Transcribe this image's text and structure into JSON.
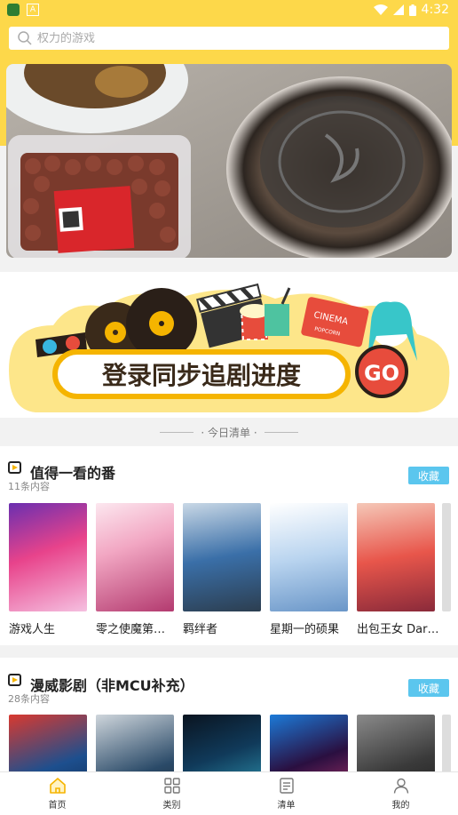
{
  "status_bar": {
    "time": "4:32"
  },
  "search": {
    "placeholder": "权力的游戏"
  },
  "today_list": {
    "label": "今日清单"
  },
  "promo": {
    "text": "登录同步追剧进度",
    "go_label": "GO",
    "cinema_label": "CINEMA",
    "popcorn_label": "POPCORN"
  },
  "sections": [
    {
      "title": "值得一看的番",
      "count": "11条内容",
      "fav_label": "收藏",
      "items": [
        {
          "title": "游戏人生",
          "colors": [
            "#e8438b",
            "#6a2fb0",
            "#f5c0e0"
          ]
        },
        {
          "title": "零之使魔第…",
          "colors": [
            "#f2a7c3",
            "#b33a6f",
            "#fce7ef"
          ]
        },
        {
          "title": "羁绊者",
          "colors": [
            "#3a6fa8",
            "#c9d8e6",
            "#2c3e50"
          ]
        },
        {
          "title": "星期一的硕果",
          "colors": [
            "#b9d4ef",
            "#ffffff",
            "#6a96c8"
          ]
        },
        {
          "title": "出包王女 Dar…",
          "colors": [
            "#e8564b",
            "#f5c8b8",
            "#8a2a3a"
          ]
        }
      ]
    },
    {
      "title": "漫威影剧（非MCU补充）",
      "count": "28条内容",
      "fav_label": "收藏",
      "items": [
        {
          "title": "",
          "colors": [
            "#1d4f8e",
            "#d9392f",
            "#0b1e3a"
          ]
        },
        {
          "title": "",
          "colors": [
            "#cfd6dc",
            "#2a4a68",
            "#1a1a1a"
          ]
        },
        {
          "title": "",
          "colors": [
            "#103a5a",
            "#3cc0d8",
            "#0a1420"
          ]
        },
        {
          "title": "",
          "colors": [
            "#2a0f40",
            "#e3427b",
            "#1c7ad8"
          ]
        },
        {
          "title": "",
          "colors": [
            "#3a3a3a",
            "#8a8a8a",
            "#111111"
          ]
        }
      ]
    }
  ],
  "tabs": [
    {
      "label": "首页",
      "icon": "home-icon",
      "active": true
    },
    {
      "label": "类别",
      "icon": "grid-icon",
      "active": false
    },
    {
      "label": "清单",
      "icon": "list-icon",
      "active": false
    },
    {
      "label": "我的",
      "icon": "person-icon",
      "active": false
    }
  ],
  "colors": {
    "brand_yellow": "#fdd84a",
    "fav_blue": "#5bc6ee",
    "accent_orange": "#f5b400"
  }
}
